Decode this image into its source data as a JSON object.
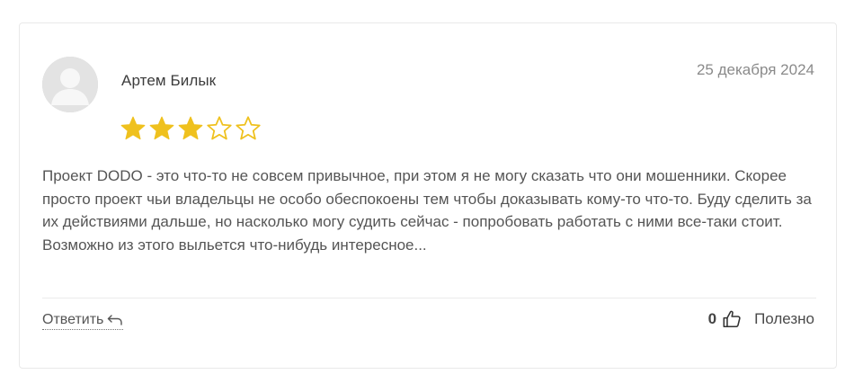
{
  "review": {
    "author": "Артем Билык",
    "date": "25 декабря 2024",
    "rating": 3,
    "rating_max": 5,
    "text": "Проект DODO - это что-то не совсем привычное, при этом я не могу сказать что они мошенники. Скорее просто проект чьи владельцы не особо обеспокоены тем чтобы доказывать кому-то что-то. Буду сделить за их действиями дальше, но насколько могу судить сейчас - попробовать работать с ними все-таки стоит. Возможно из этого выльется что-нибудь интересное...",
    "avatar_icon": "user-placeholder-icon"
  },
  "actions": {
    "reply_label": "Ответить",
    "reply_icon": "reply-arrow-icon",
    "helpful_count": "0",
    "helpful_icon": "thumbs-up-icon",
    "helpful_label": "Полезно"
  },
  "colors": {
    "star_filled": "#EFC11E",
    "star_outline": "#EFC11E",
    "card_border": "#E9E9E9"
  }
}
